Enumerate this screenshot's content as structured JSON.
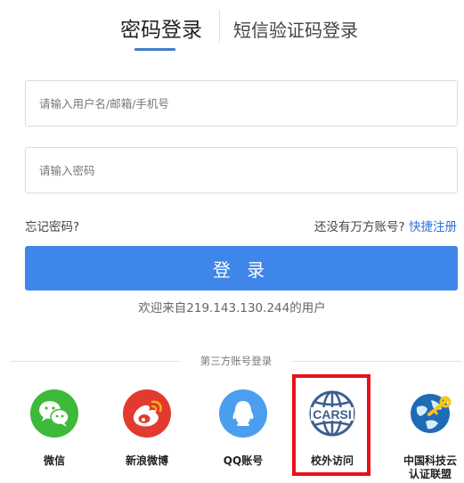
{
  "tabs": {
    "password_login": "密码登录",
    "sms_login": "短信验证码登录"
  },
  "form": {
    "username_placeholder": "请输入用户名/邮箱/手机号",
    "password_placeholder": "请输入密码",
    "forgot_password": "忘记密码?",
    "no_account_prompt": "还没有万方账号?",
    "quick_register": "快捷注册",
    "login_button": "登 录"
  },
  "welcome": "欢迎来自219.143.130.244的用户",
  "third_party": {
    "title": "第三方账号登录",
    "items": [
      {
        "label": "微信",
        "icon": "wechat-icon",
        "color": "#3eb93a"
      },
      {
        "label": "新浪微博",
        "icon": "weibo-icon",
        "color": "#e23a2f"
      },
      {
        "label": "QQ账号",
        "icon": "qq-icon",
        "color": "#4c9ef0"
      },
      {
        "label": "校外访问",
        "icon": "carsi-icon",
        "logo_text": "CARSI",
        "color": "#3c5f8f"
      },
      {
        "label": "中国科技云\n认证联盟",
        "icon": "cstcloud-icon",
        "color": "#1f6bb5"
      }
    ],
    "highlight_color": "#e8101a"
  },
  "colors": {
    "primary": "#3f86ea",
    "link": "#2f73d8",
    "tab_active_underline": "#417dc9"
  }
}
